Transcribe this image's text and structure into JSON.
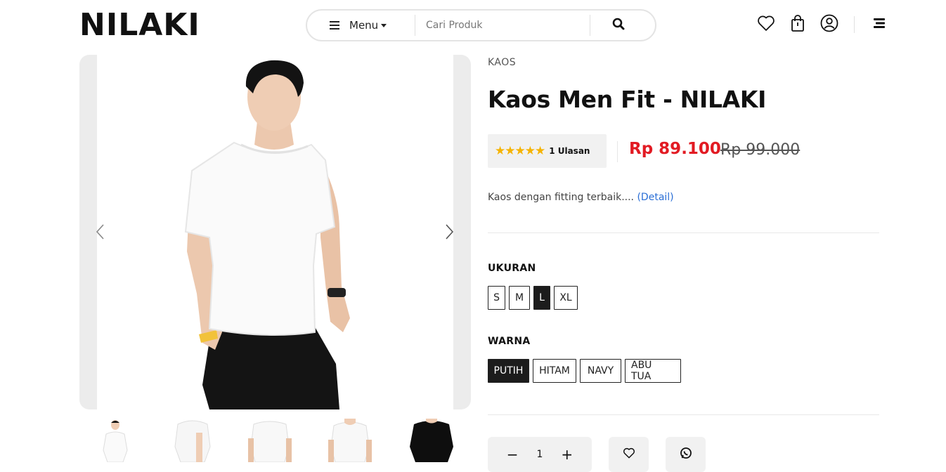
{
  "header": {
    "logo": "NILAKI",
    "menu_label": "Menu",
    "search_placeholder": "Cari Produk"
  },
  "product": {
    "category": "KAOS",
    "title": "Kaos Men Fit - NILAKI",
    "rating_stars": 5,
    "reviews_label": "1 Ulasan",
    "price": "Rp 89.100",
    "old_price": "Rp 99.000",
    "short_description": "Kaos dengan fitting terbaik.... ",
    "detail_link": "(Detail)",
    "size_label": "UKURAN",
    "sizes": [
      {
        "label": "S",
        "selected": false
      },
      {
        "label": "M",
        "selected": false
      },
      {
        "label": "L",
        "selected": true
      },
      {
        "label": "XL",
        "selected": false
      }
    ],
    "color_label": "WARNA",
    "colors": [
      {
        "label": "PUTIH",
        "selected": true
      },
      {
        "label": "HITAM",
        "selected": false
      },
      {
        "label": "NAVY",
        "selected": false
      },
      {
        "label": "ABU TUA",
        "selected": false
      }
    ],
    "quantity": "1",
    "minus": "−",
    "plus": "+"
  },
  "theme": {
    "accent_price": "#e21b23",
    "star_color": "#f5b301",
    "link_color": "#2b6fd6"
  },
  "icons": {
    "menu": "hamburger-icon",
    "search": "search-icon",
    "wishlist": "heart-icon",
    "cart": "shopping-bag-icon",
    "account": "user-circle-icon",
    "more": "stacked-menu-icon",
    "whatsapp": "whatsapp-icon"
  }
}
